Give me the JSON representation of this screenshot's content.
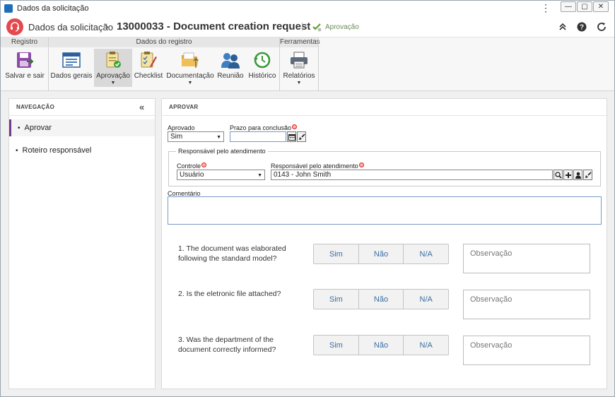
{
  "window": {
    "title": "Dados da solicitação"
  },
  "header": {
    "app_name": "Dados da solicitação",
    "separator": "›",
    "record_title": "13000033 - Document creation request",
    "status": "Aprovação"
  },
  "ribbon": {
    "groups": [
      "Registro",
      "Dados do registro",
      "Ferramentas"
    ],
    "buttons": {
      "salvar_sair": "Salvar e sair",
      "dados_gerais": "Dados gerais",
      "aprovacao": "Aprovação",
      "checklist": "Checklist",
      "documentacao": "Documentação",
      "reuniao": "Reunião",
      "historico": "Histórico",
      "relatorios": "Relatórios"
    }
  },
  "nav": {
    "title": "NAVEGAÇÃO",
    "items": [
      "Aprovar",
      "Roteiro responsável"
    ],
    "selected": "Aprovar"
  },
  "form": {
    "section_title": "APROVAR",
    "aprovado_label": "Aprovado",
    "aprovado_value": "Sim",
    "prazo_label": "Prazo para conclusão",
    "prazo_value": "",
    "group_legend": "Responsável pelo atendimento",
    "controle_label": "Controle",
    "controle_value": "Usuário",
    "responsavel_label": "Responsável pelo atendimento",
    "responsavel_value": "0143 - John Smith",
    "comentario_label": "Comentário",
    "comentario_value": ""
  },
  "checklist": {
    "options": [
      "Sim",
      "Não",
      "N/A"
    ],
    "obs_placeholder": "Observação",
    "questions": [
      "1. The document was elaborated following the standard model?",
      "2. Is the eletronic file attached?",
      "3. Was the department of the document correctly informed?"
    ]
  },
  "colors": {
    "accent_nav": "#6e3b8d",
    "logo": "#e5484d",
    "option_text": "#3a6ea5",
    "status_text": "#6b8a5a"
  }
}
